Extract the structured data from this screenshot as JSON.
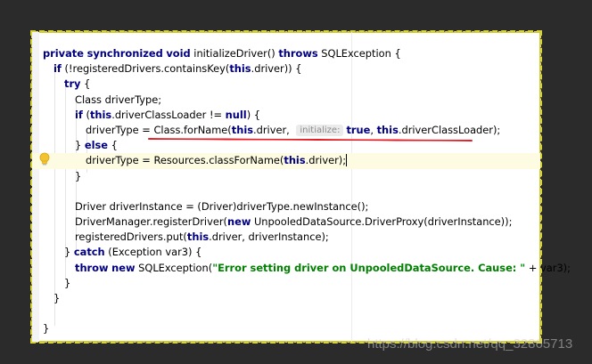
{
  "code_lines": [
    {
      "indent": 0,
      "parts": [
        [
          "kw",
          "private"
        ],
        [
          "t",
          " "
        ],
        [
          "kw",
          "synchronized"
        ],
        [
          "t",
          " "
        ],
        [
          "kw",
          "void"
        ],
        [
          "t",
          " initializeDriver() "
        ],
        [
          "kw",
          "throws"
        ],
        [
          "t",
          " SQLException {"
        ]
      ]
    },
    {
      "indent": 1,
      "parts": [
        [
          "kw",
          "if"
        ],
        [
          "t",
          " (!registeredDrivers.containsKey("
        ],
        [
          "kw",
          "this"
        ],
        [
          "t",
          ".driver)) {"
        ]
      ]
    },
    {
      "indent": 2,
      "parts": [
        [
          "kw",
          "try"
        ],
        [
          "t",
          " {"
        ]
      ]
    },
    {
      "indent": 3,
      "parts": [
        [
          "t",
          "Class driverType;"
        ]
      ]
    },
    {
      "indent": 3,
      "parts": [
        [
          "kw",
          "if"
        ],
        [
          "t",
          " ("
        ],
        [
          "kw",
          "this"
        ],
        [
          "t",
          ".driverClassLoader != "
        ],
        [
          "kw",
          "null"
        ],
        [
          "t",
          ") {"
        ]
      ]
    },
    {
      "indent": 4,
      "parts": [
        [
          "t",
          "driverType = Class.forName("
        ],
        [
          "kw",
          "this"
        ],
        [
          "t",
          ".driver, "
        ],
        [
          "hint",
          "initialize:"
        ],
        [
          "kw",
          "true"
        ],
        [
          "t",
          ", "
        ],
        [
          "kw",
          "this"
        ],
        [
          "t",
          ".driverClassLoader);"
        ]
      ]
    },
    {
      "indent": 3,
      "parts": [
        [
          "t",
          "} "
        ],
        [
          "kw",
          "else"
        ],
        [
          "t",
          " {"
        ]
      ]
    },
    {
      "indent": 4,
      "highlight": true,
      "parts": [
        [
          "t",
          "driverType = Resources.classForName("
        ],
        [
          "kw",
          "this"
        ],
        [
          "t",
          ".driver);"
        ],
        [
          "caret",
          ""
        ]
      ]
    },
    {
      "indent": 3,
      "parts": [
        [
          "t",
          "}"
        ]
      ]
    },
    {
      "indent": 0,
      "parts": []
    },
    {
      "indent": 3,
      "parts": [
        [
          "t",
          "Driver driverInstance = (Driver)driverType.newInstance();"
        ]
      ]
    },
    {
      "indent": 3,
      "parts": [
        [
          "t",
          "DriverManager.registerDriver("
        ],
        [
          "kw",
          "new"
        ],
        [
          "t",
          " UnpooledDataSource.DriverProxy(driverInstance));"
        ]
      ]
    },
    {
      "indent": 3,
      "parts": [
        [
          "t",
          "registeredDrivers.put("
        ],
        [
          "kw",
          "this"
        ],
        [
          "t",
          ".driver, driverInstance);"
        ]
      ]
    },
    {
      "indent": 2,
      "parts": [
        [
          "t",
          "} "
        ],
        [
          "kw",
          "catch"
        ],
        [
          "t",
          " (Exception var3) {"
        ]
      ]
    },
    {
      "indent": 3,
      "parts": [
        [
          "kw",
          "throw"
        ],
        [
          "t",
          " "
        ],
        [
          "kw",
          "new"
        ],
        [
          "t",
          " SQLException("
        ],
        [
          "str",
          "\"Error setting driver on UnpooledDataSource. Cause: \""
        ],
        [
          "t",
          " + var3);"
        ]
      ]
    },
    {
      "indent": 2,
      "parts": [
        [
          "t",
          "}"
        ]
      ]
    },
    {
      "indent": 1,
      "parts": [
        [
          "t",
          "}"
        ]
      ]
    },
    {
      "indent": 0,
      "parts": []
    },
    {
      "indent": 0,
      "parts": [
        [
          "t",
          "}"
        ]
      ]
    }
  ],
  "intention_bulb": "lightbulb-icon",
  "underline_color": "#e51c23",
  "watermark": "https://blog.csdn.net/qq_32865713"
}
